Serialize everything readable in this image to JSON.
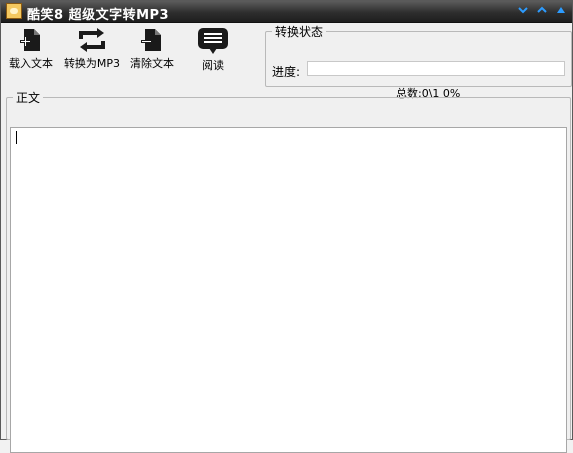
{
  "window": {
    "title": "酷笑8 超级文字转MP3",
    "controls": [
      "minimize-to-tray",
      "minimize",
      "maximize"
    ]
  },
  "toolbar": {
    "load_text": "载入文本",
    "convert_mp3": "转换为MP3",
    "clear_text": "清除文本",
    "read": "阅读"
  },
  "status": {
    "group_title": "转换状态",
    "progress_label": "进度:",
    "progress_value": 0,
    "count_text": "总数:0\\1 0%"
  },
  "body": {
    "group_title": "正文",
    "text_value": ""
  },
  "colors": {
    "titlebar_dark": "#2e2e2e",
    "title_text": "#ffffff",
    "control_blue": "#2d9cff",
    "window_bg": "#f0f0f0",
    "progress_fill": "#3a8ee6"
  }
}
